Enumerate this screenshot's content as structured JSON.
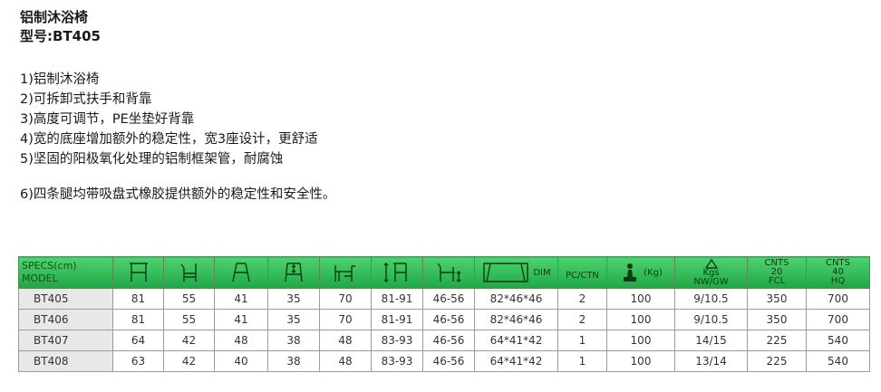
{
  "title": "铝制沐浴椅",
  "model": "型号:BT405",
  "features": [
    "1)铝制沐浴椅",
    "2)可拆卸式扶手和背靠",
    "3)高度可调节，PE坐垫好背靠",
    "4)宽的底座增加额外的稳定性，宽3座设计，更舒适",
    "5)坚固的阳极氧化处理的铝制框架管，耐腐蚀",
    "6)四条腿均带吸盘式橡胶提供额外的稳定性和安全性。"
  ],
  "table": {
    "header_specs": "SPECS(cm)",
    "header_model": "MODEL",
    "header_dim": "DIM",
    "header_pcctn": "PC/CTN",
    "header_weight_unit": "(Kg)",
    "header_nwgw_top": "Kgs",
    "header_nwgw": "NW/GW",
    "header_cnts20": [
      "CNTS",
      "20",
      "FCL"
    ],
    "header_cnts40": [
      "CNTS",
      "40",
      "HQ"
    ],
    "rows": [
      [
        "BT405",
        "81",
        "55",
        "41",
        "35",
        "70",
        "81-91",
        "46-56",
        "82*46*46",
        "2",
        "100",
        "9/10.5",
        "350",
        "700"
      ],
      [
        "BT406",
        "81",
        "55",
        "41",
        "35",
        "70",
        "81-91",
        "46-56",
        "82*46*46",
        "2",
        "100",
        "9/10.5",
        "350",
        "700"
      ],
      [
        "BT407",
        "64",
        "42",
        "48",
        "38",
        "48",
        "83-93",
        "46-56",
        "64*41*42",
        "1",
        "100",
        "14/15",
        "225",
        "540"
      ],
      [
        "BT408",
        "63",
        "42",
        "40",
        "38",
        "48",
        "83-93",
        "46-56",
        "64*41*42",
        "1",
        "100",
        "13/14",
        "225",
        "540"
      ]
    ]
  },
  "colors": {
    "header_green": "#2bb552",
    "label_gray": "#e8e8e8",
    "grid": "#9a9a9a"
  }
}
